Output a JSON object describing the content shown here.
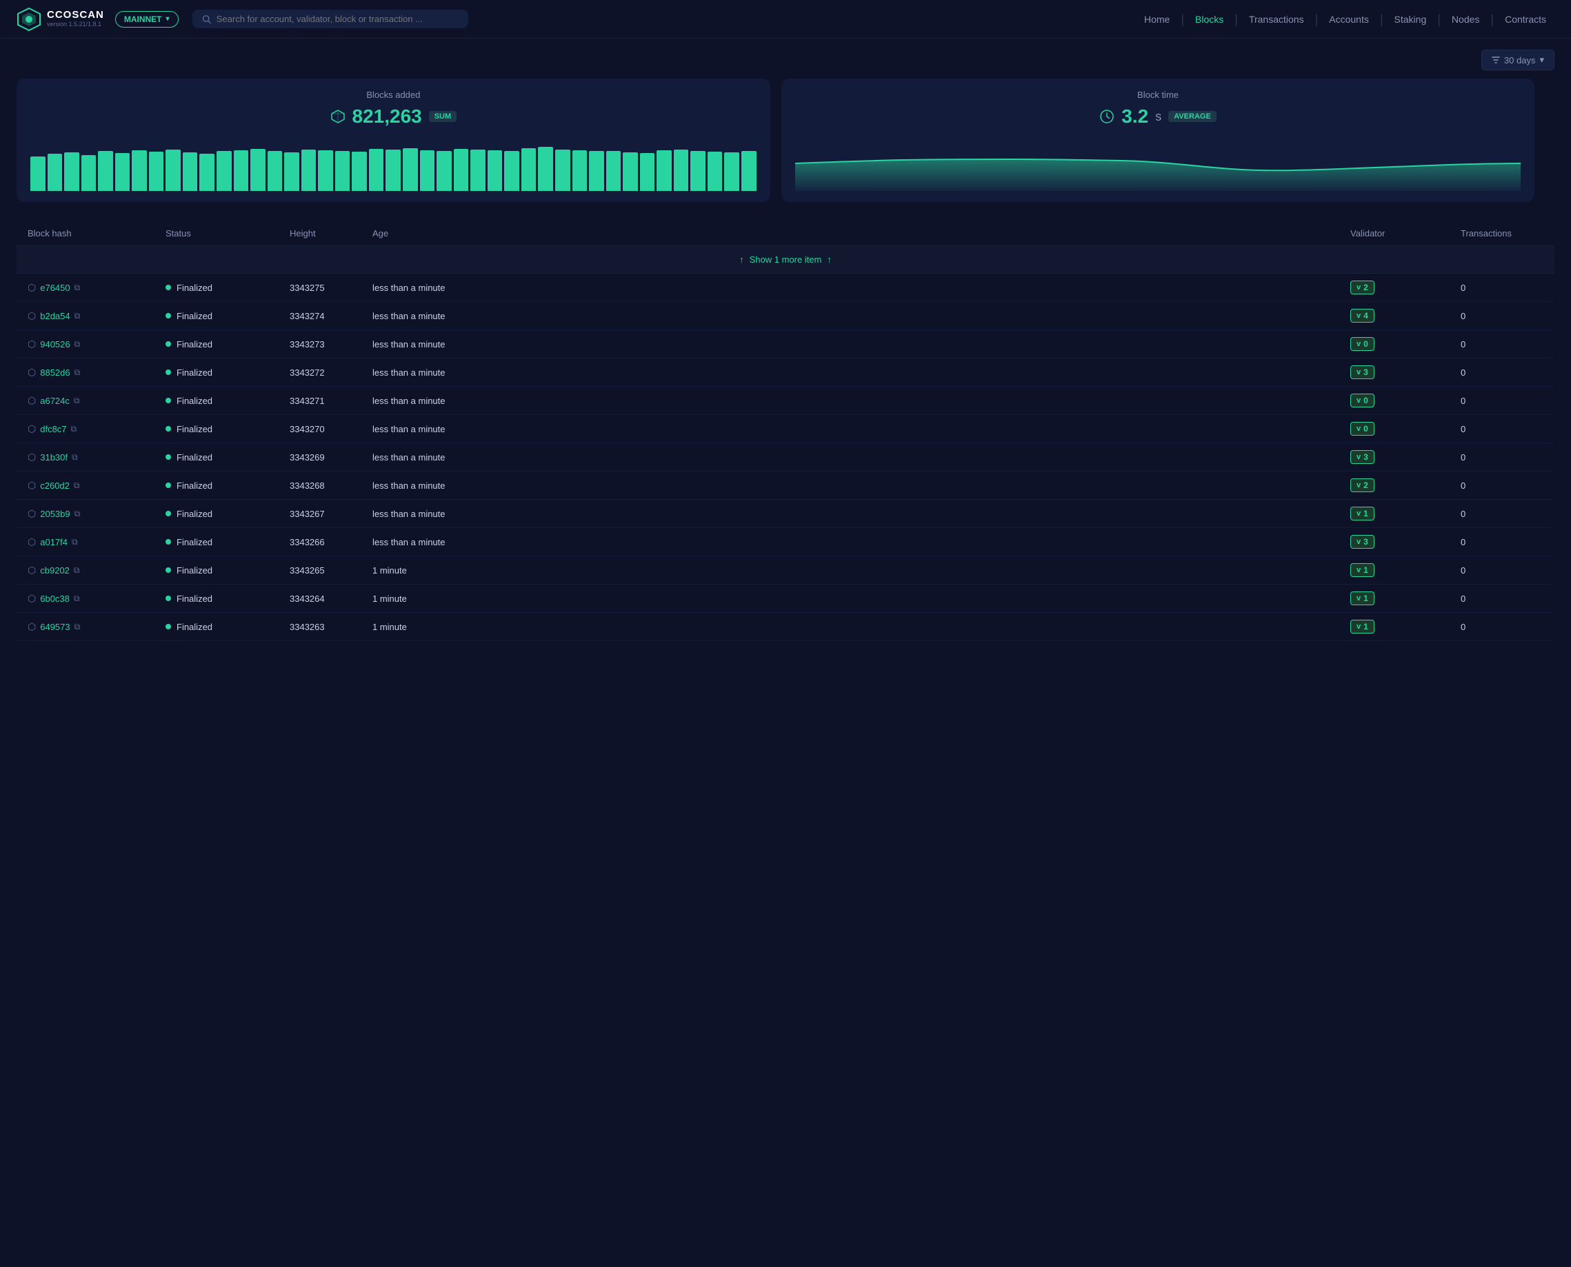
{
  "app": {
    "logo_name": "CCOSCAN",
    "logo_version": "version 1.5.21/1.8.1",
    "network": "MAINNET"
  },
  "navbar": {
    "search_placeholder": "Search for account, validator, block or transaction ...",
    "links": [
      {
        "label": "Home",
        "active": false
      },
      {
        "label": "Blocks",
        "active": true
      },
      {
        "label": "Transactions",
        "active": false
      },
      {
        "label": "Accounts",
        "active": false
      },
      {
        "label": "Staking",
        "active": false
      },
      {
        "label": "Nodes",
        "active": false
      },
      {
        "label": "Contracts",
        "active": false
      }
    ]
  },
  "filter": {
    "label": "30 days"
  },
  "charts": {
    "left": {
      "label": "Blocks added",
      "value": "821,263",
      "badge": "SUM"
    },
    "right": {
      "label": "Block time",
      "value": "3.2",
      "unit": "s",
      "badge": "AVERAGE"
    }
  },
  "bar_heights": [
    62,
    68,
    70,
    65,
    72,
    69,
    74,
    71,
    75,
    70,
    68,
    73,
    74,
    76,
    72,
    70,
    75,
    74,
    73,
    71,
    76,
    75,
    77,
    74,
    72,
    76,
    75,
    74,
    72,
    78,
    80,
    75,
    74,
    73,
    72,
    70,
    69,
    74,
    75,
    73,
    71,
    70,
    72
  ],
  "table": {
    "headers": [
      "Block hash",
      "Status",
      "Height",
      "Age",
      "Validator",
      "Transactions"
    ],
    "show_more": "Show 1 more item",
    "rows": [
      {
        "hash": "e76450",
        "status": "Finalized",
        "height": "3343275",
        "age": "less than a minute",
        "validator": "2",
        "txns": "0"
      },
      {
        "hash": "b2da54",
        "status": "Finalized",
        "height": "3343274",
        "age": "less than a minute",
        "validator": "4",
        "txns": "0"
      },
      {
        "hash": "940526",
        "status": "Finalized",
        "height": "3343273",
        "age": "less than a minute",
        "validator": "0",
        "txns": "0"
      },
      {
        "hash": "8852d6",
        "status": "Finalized",
        "height": "3343272",
        "age": "less than a minute",
        "validator": "3",
        "txns": "0"
      },
      {
        "hash": "a6724c",
        "status": "Finalized",
        "height": "3343271",
        "age": "less than a minute",
        "validator": "0",
        "txns": "0"
      },
      {
        "hash": "dfc8c7",
        "status": "Finalized",
        "height": "3343270",
        "age": "less than a minute",
        "validator": "0",
        "txns": "0"
      },
      {
        "hash": "31b30f",
        "status": "Finalized",
        "height": "3343269",
        "age": "less than a minute",
        "validator": "3",
        "txns": "0"
      },
      {
        "hash": "c260d2",
        "status": "Finalized",
        "height": "3343268",
        "age": "less than a minute",
        "validator": "2",
        "txns": "0"
      },
      {
        "hash": "2053b9",
        "status": "Finalized",
        "height": "3343267",
        "age": "less than a minute",
        "validator": "1",
        "txns": "0"
      },
      {
        "hash": "a017f4",
        "status": "Finalized",
        "height": "3343266",
        "age": "less than a minute",
        "validator": "3",
        "txns": "0"
      },
      {
        "hash": "cb9202",
        "status": "Finalized",
        "height": "3343265",
        "age": "1 minute",
        "validator": "1",
        "txns": "0"
      },
      {
        "hash": "6b0c38",
        "status": "Finalized",
        "height": "3343264",
        "age": "1 minute",
        "validator": "1",
        "txns": "0"
      },
      {
        "hash": "649573",
        "status": "Finalized",
        "height": "3343263",
        "age": "1 minute",
        "validator": "1",
        "txns": "0"
      }
    ]
  }
}
